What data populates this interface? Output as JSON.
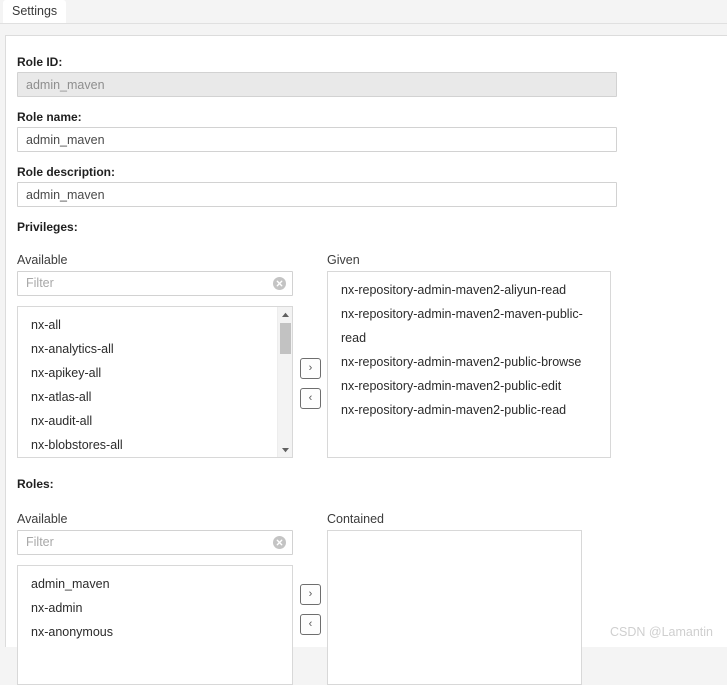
{
  "tab": {
    "label": "Settings"
  },
  "form": {
    "role_id": {
      "label": "Role ID:",
      "value": "admin_maven",
      "disabled": true
    },
    "role_name": {
      "label": "Role name:",
      "value": "admin_maven"
    },
    "role_description": {
      "label": "Role description:",
      "value": "admin_maven"
    }
  },
  "privileges": {
    "label": "Privileges:",
    "available": {
      "caption": "Available",
      "filter_placeholder": "Filter",
      "filter_value": "",
      "clear_icon": "clear-circle-icon",
      "items": [
        "nx-all",
        "nx-analytics-all",
        "nx-apikey-all",
        "nx-atlas-all",
        "nx-audit-all",
        "nx-blobstores-all"
      ]
    },
    "given": {
      "caption": "Given",
      "items": [
        "nx-repository-admin-maven2-aliyun-read",
        "nx-repository-admin-maven2-maven-public-read",
        "nx-repository-admin-maven2-public-browse",
        "nx-repository-admin-maven2-public-edit",
        "nx-repository-admin-maven2-public-read"
      ]
    },
    "add_button": {
      "icon": "chevron-right-icon",
      "glyph": "›"
    },
    "remove_button": {
      "icon": "chevron-left-icon",
      "glyph": "‹"
    }
  },
  "roles": {
    "label": "Roles:",
    "available": {
      "caption": "Available",
      "filter_placeholder": "Filter",
      "filter_value": "",
      "clear_icon": "clear-circle-icon",
      "items": [
        "admin_maven",
        "nx-admin",
        "nx-anonymous"
      ]
    },
    "contained": {
      "caption": "Contained",
      "items": []
    },
    "add_button": {
      "icon": "chevron-right-icon",
      "glyph": "›"
    },
    "remove_button": {
      "icon": "chevron-left-icon",
      "glyph": "‹"
    }
  },
  "watermark": {
    "text": "CSDN @Lamantin"
  },
  "colors": {
    "panel_background": "#ffffff",
    "page_background": "#f4f4f4",
    "border": "#d8d8d8",
    "disabled_field": "#e9e9e9",
    "scroll_thumb": "#c2c2c2",
    "watermark": "#cfcfcf"
  }
}
